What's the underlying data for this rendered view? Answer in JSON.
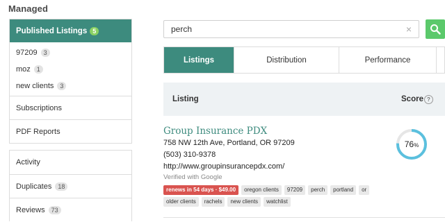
{
  "sidebar": {
    "heading": "Managed",
    "published": {
      "label": "Published Listings",
      "count": "5"
    },
    "sub_items": [
      {
        "label": "97209",
        "count": "3"
      },
      {
        "label": "moz",
        "count": "1"
      },
      {
        "label": "new clients",
        "count": "3"
      }
    ],
    "menu": [
      {
        "label": "Subscriptions"
      },
      {
        "label": "PDF Reports"
      }
    ],
    "menu2": [
      {
        "label": "Activity"
      },
      {
        "label": "Duplicates",
        "count": "18"
      },
      {
        "label": "Reviews",
        "count": "73"
      }
    ]
  },
  "search": {
    "value": "perch",
    "clear_icon": "×"
  },
  "tabs": [
    {
      "label": "Listings"
    },
    {
      "label": "Distribution"
    },
    {
      "label": "Performance"
    }
  ],
  "table": {
    "col_listing": "Listing",
    "col_score": "Score",
    "help": "?"
  },
  "listing": {
    "name": "Group Insurance PDX",
    "address": "758 NW 12th Ave, Portland, OR 97209",
    "phone": "(503) 310-9378",
    "url": "http://www.groupinsurancepdx.com/",
    "verified": "Verified with Google",
    "renew_tag": "renews in 54 days · $49.00",
    "tags": [
      "oregon clients",
      "97209",
      "perch",
      "portland",
      "or",
      "older clients",
      "rachels",
      "new clients",
      "watchlist"
    ],
    "score": {
      "value": "76",
      "unit": "%",
      "fraction": 0.76
    }
  },
  "colors": {
    "accent": "#3d8b7e",
    "search_button": "#5bc96b",
    "renew": "#d9534f",
    "score_ring": "#5bc0de"
  }
}
